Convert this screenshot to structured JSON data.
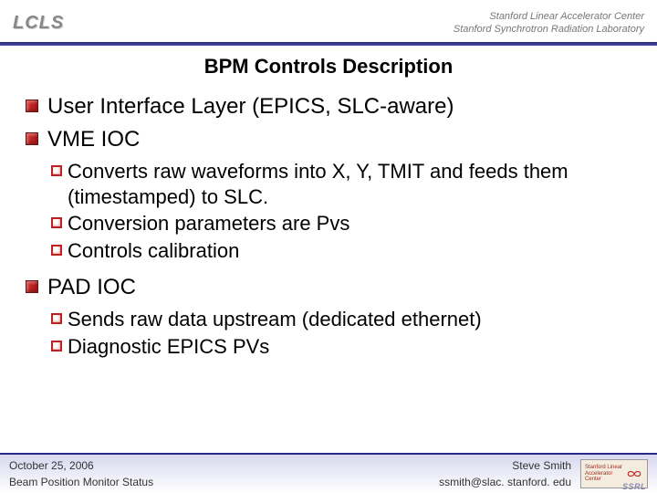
{
  "header": {
    "logo_left": "LCLS",
    "logo_right_line1": "Stanford Linear Accelerator Center",
    "logo_right_line2": "Stanford Synchrotron Radiation Laboratory"
  },
  "title": "BPM Controls Description",
  "bullets": {
    "l1_1": "User Interface Layer (EPICS, SLC-aware)",
    "l1_2": "VME IOC",
    "l2_1": "Converts raw waveforms into X, Y, TMIT and feeds them (timestamped) to SLC.",
    "l2_2": "Conversion parameters are Pvs",
    "l2_3": "Controls calibration",
    "l1_3": "PAD IOC",
    "l2_4": "Sends raw data upstream (dedicated ethernet)",
    "l2_5": "Diagnostic EPICS PVs"
  },
  "footer": {
    "date": "October  25, 2006",
    "subtitle": "Beam Position Monitor Status",
    "author": "Steve Smith",
    "email": "ssmith@slac. stanford. edu",
    "logo_text1": "Stanford Linear",
    "logo_text2": "Accelerator",
    "logo_text3": "Center",
    "ssrl": "SSRL"
  }
}
